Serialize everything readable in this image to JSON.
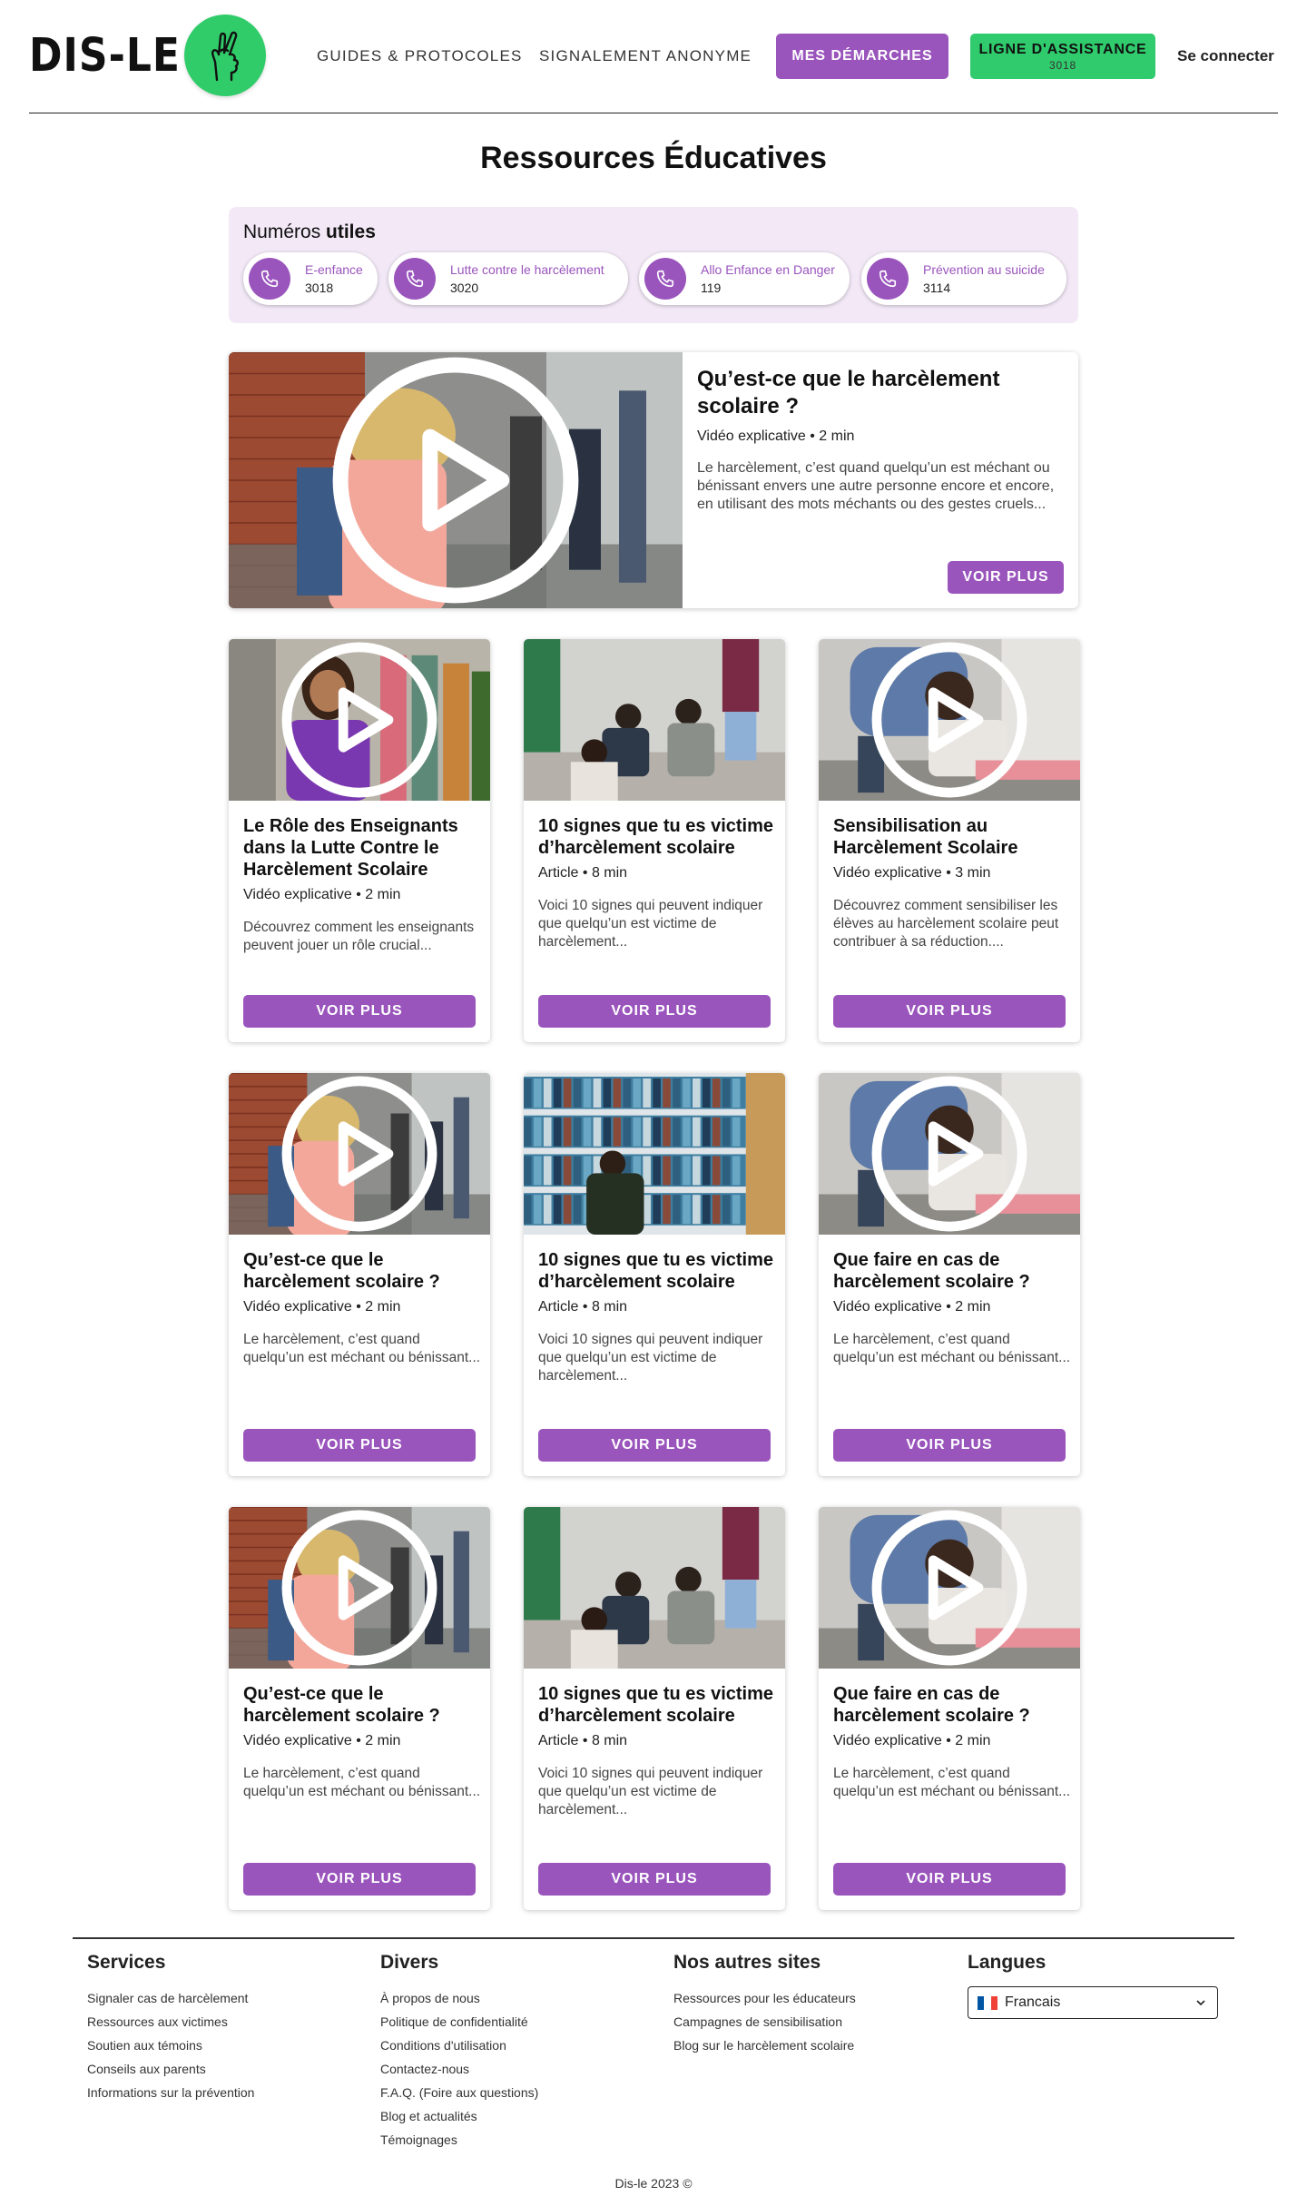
{
  "header": {
    "logo_text": "DIS-LE",
    "nav": [
      "GUIDES & PROTOCOLES",
      "SIGNALEMENT ANONYME"
    ],
    "my_steps_button": "MES DÉMARCHES",
    "helpline_button": "LIGNE D'ASSISTANCE",
    "helpline_number": "3018",
    "login": "Se connecter"
  },
  "page_title": "Ressources Éducatives",
  "numbers": {
    "title_plain": "Numéros ",
    "title_bold": "utiles",
    "items": [
      {
        "name": "E-enfance",
        "number": "3018"
      },
      {
        "name": "Lutte contre le harcèlement",
        "number": "3020"
      },
      {
        "name": "Allo Enfance en Danger",
        "number": "119"
      },
      {
        "name": "Prévention au suicide",
        "number": "3114"
      }
    ]
  },
  "featured": {
    "title": "Qu’est-ce que le harcèlement scolaire ?",
    "meta": "Vidéo explicative • 2 min",
    "description": "Le harcèlement, c’est quand quelqu’un est méchant ou bénissant envers une autre personne encore et encore, en utilisant des mots méchants ou des gestes cruels...",
    "button": "VOIR PLUS"
  },
  "cards": [
    {
      "title": "Le Rôle des Enseignants dans la Lutte Contre le Harcèlement Scolaire",
      "meta": "Vidéo explicative • 2 min",
      "description": "Découvrez comment les enseignants peuvent jouer un rôle crucial...",
      "button": "VOIR PLUS",
      "video": true,
      "scene": "girl-purple"
    },
    {
      "title": "10 signes que tu es victime d’harcèlement scolaire",
      "meta": "Article • 8 min",
      "description": "Voici 10 signes qui peuvent indiquer que quelqu’un est victime de harcèlement...",
      "button": "VOIR PLUS",
      "video": false,
      "scene": "group-floor"
    },
    {
      "title": "Sensibilisation au Harcèlement Scolaire",
      "meta": "Vidéo explicative • 3 min",
      "description": "Découvrez comment sensibiliser les élèves au harcèlement scolaire peut contribuer à sa réduction....",
      "button": "VOIR PLUS",
      "video": true,
      "scene": "hug"
    },
    {
      "title": "Qu’est-ce que le harcèlement scolaire ?",
      "meta": "Vidéo explicative • 2 min",
      "description": "Le harcèlement, c’est quand quelqu’un est méchant ou bénissant...",
      "button": "VOIR PLUS",
      "video": true,
      "scene": "girl-wall"
    },
    {
      "title": "10 signes que tu es victime d’harcèlement scolaire",
      "meta": "Article • 8 min",
      "description": "Voici 10 signes qui peuvent indiquer que quelqu’un est victime de harcèlement...",
      "button": "VOIR PLUS",
      "video": false,
      "scene": "library"
    },
    {
      "title": "Que faire en cas de harcèlement scolaire ?",
      "meta": "Vidéo explicative • 2 min",
      "description": "Le harcèlement, c’est quand quelqu’un est méchant ou bénissant...",
      "button": "VOIR PLUS",
      "video": true,
      "scene": "hug"
    },
    {
      "title": "Qu’est-ce que le harcèlement scolaire ?",
      "meta": "Vidéo explicative • 2 min",
      "description": "Le harcèlement, c’est quand quelqu’un est méchant ou bénissant...",
      "button": "VOIR PLUS",
      "video": true,
      "scene": "girl-wall"
    },
    {
      "title": "10 signes que tu es victime d’harcèlement scolaire",
      "meta": "Article • 8 min",
      "description": "Voici 10 signes qui peuvent indiquer que quelqu’un est victime de harcèlement...",
      "button": "VOIR PLUS",
      "video": false,
      "scene": "group-floor"
    },
    {
      "title": "Que faire en cas de harcèlement scolaire ?",
      "meta": "Vidéo explicative • 2 min",
      "description": "Le harcèlement, c’est quand quelqu’un est méchant ou bénissant...",
      "button": "VOIR PLUS",
      "video": true,
      "scene": "hug"
    }
  ],
  "footer": {
    "services": {
      "title": "Services",
      "links": [
        "Signaler cas de harcèlement",
        "Ressources aux victimes",
        "Soutien aux témoins",
        "Conseils aux parents",
        "Informations sur la prévention"
      ]
    },
    "divers": {
      "title": "Divers",
      "links": [
        "À propos de nous",
        "Politique de confidentialité",
        "Conditions d'utilisation",
        "Contactez-nous",
        "F.A.Q. (Foire aux questions)",
        "Blog et actualités",
        "Témoignages"
      ]
    },
    "sites": {
      "title": "Nos autres sites",
      "links": [
        "Ressources pour les éducateurs",
        "Campagnes de sensibilisation",
        "Blog sur le harcèlement scolaire"
      ]
    },
    "langues": {
      "title": "Langues",
      "selected": "Francais"
    },
    "copyright": "Dis-le 2023 ©"
  },
  "colors": {
    "purple": "#9a55bd",
    "green": "#2fcb6c",
    "lavender": "#f2e8f6"
  }
}
